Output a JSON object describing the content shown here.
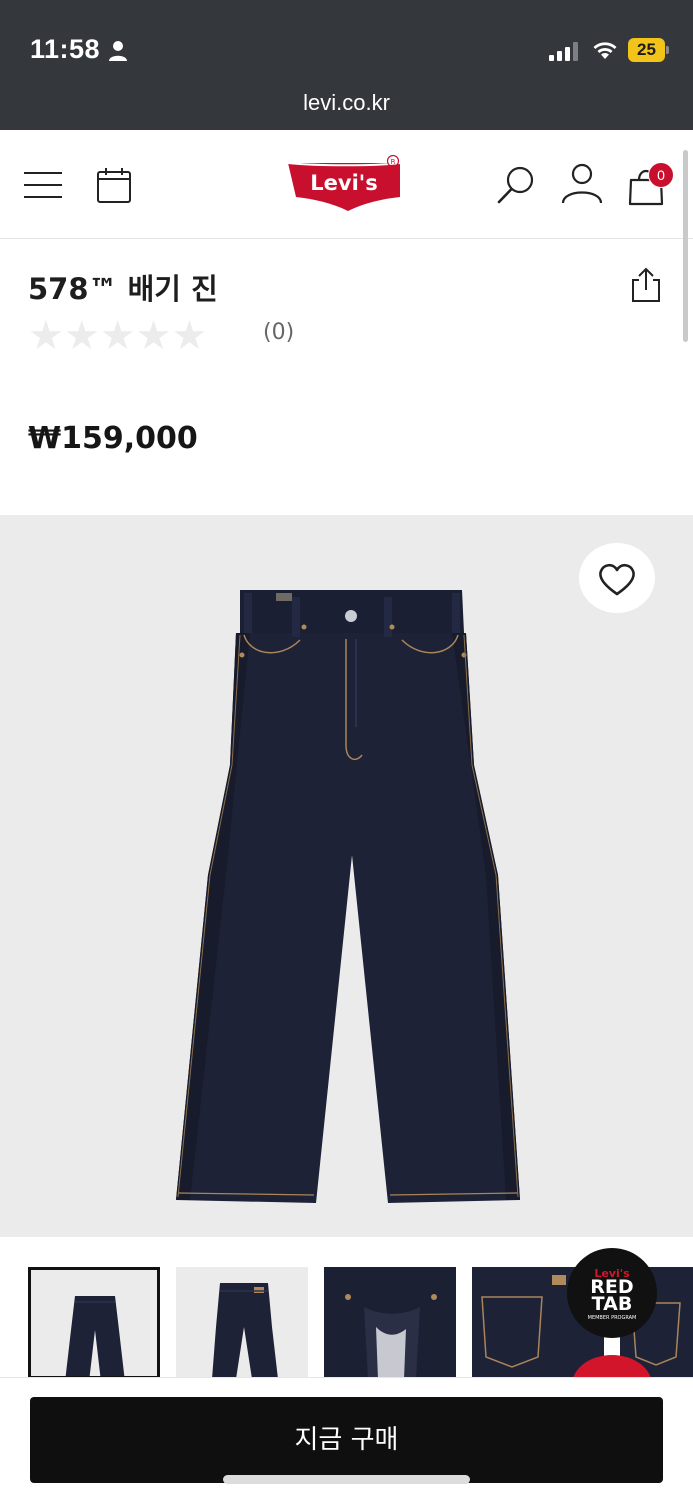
{
  "status_bar": {
    "time": "11:58",
    "battery_level": "25"
  },
  "browser": {
    "url": "levi.co.kr"
  },
  "header": {
    "logo_text": "Levi's",
    "cart_count": "0",
    "icons": [
      "menu-icon",
      "calendar-icon",
      "search-icon",
      "account-icon",
      "cart-icon"
    ]
  },
  "product": {
    "title": "578™ 배기 진",
    "rating_stars": 0,
    "rating_max": 5,
    "review_count": "(0)",
    "price": "₩159,000",
    "thumbnail_count": 5
  },
  "badge": {
    "line1": "Levi's",
    "line2": "RED",
    "line3": "TAB",
    "line4": "MEMBER PROGRAM"
  },
  "actions": {
    "buy_now_label": "지금 구매"
  },
  "colors": {
    "brand_red": "#c8102e",
    "chrome_bg": "#34373b",
    "denim": "#1d2236",
    "battery": "#f2c318"
  }
}
